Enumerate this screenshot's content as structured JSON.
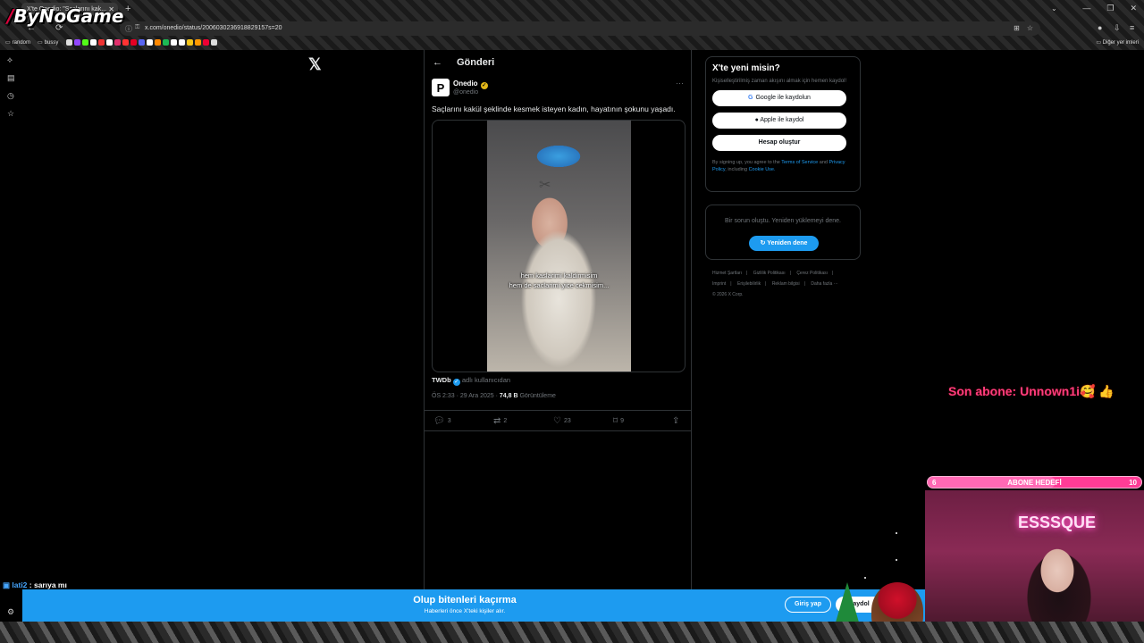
{
  "browser": {
    "tab_title": "X'te Onedio: \"Saçlarını kak...",
    "url": "x.com/onedio/status/2006030236918829157s=20",
    "bookmarks": [
      "random",
      "bussy"
    ],
    "other_bookmarks": "Diğer yer imleri",
    "overlay_logo": "ByNoGame"
  },
  "post": {
    "header_title": "Gönderi",
    "author_name": "Onedio",
    "author_handle": "@onedio",
    "text": "Saçlarını kakül şeklinde kesmek isteyen kadın, hayatının şokunu yaşadı.",
    "video_caption_line1": "hem kaslarimi kaldirmisim",
    "video_caption_line2": "hem de saclarimi yice cekmisim...",
    "credit_name": "TWDb",
    "credit_suffix": "adlı kullanıcıdan",
    "time": "ÖS 2:33 · 29 Ara 2025 · ",
    "views": "74,8 B",
    "views_label": " Görüntüleme",
    "replies": "3",
    "reposts": "2",
    "likes": "23",
    "bookmarks": "9"
  },
  "signup": {
    "title": "X'te yeni misin?",
    "subtitle": "Kişiselleştirilmiş zaman akışını almak için hemen kaydol!",
    "google": "Google ile kaydolun",
    "apple": "Apple ile kaydol",
    "create": "Hesap oluştur",
    "legal_prefix": "By signing up, you agree to the ",
    "terms": "Terms of Service",
    "and": " and ",
    "privacy": "Privacy Policy",
    "including": ", including ",
    "cookie": "Cookie Use."
  },
  "error": {
    "text": "Bir sorun oluştu. Yeniden yüklemeyi dene.",
    "retry": "Yeniden dene"
  },
  "footer": {
    "links": [
      "Hizmet Şartları",
      "|",
      "Gizlilik Politikası",
      "|",
      "Çerez Politikası",
      "|",
      "Imprint",
      "|",
      "Erişilebilirlik",
      "|",
      "Reklam bilgisi",
      "|",
      "Daha fazla ···"
    ],
    "copyright": "© 2026 X Corp."
  },
  "banner": {
    "title": "Olup bitenleri kaçırma",
    "subtitle": "Haberleri önce X'teki kişiler alır.",
    "login": "Giriş yap",
    "signup": "Kaydol"
  },
  "stream": {
    "last_sub": "Son abone: Unnown1i🥰 👍",
    "goal_label": "ABONE HEDEFİ",
    "goal_current": "6",
    "goal_target": "10",
    "goal_fraction": 0.6,
    "neon": "ESSSQUE",
    "chat_user": "lati2",
    "chat_message": " : sarıya mı"
  },
  "colors": {
    "accent": "#1d9bf0",
    "background": "#000000",
    "pink": "#ff3c96"
  },
  "icons": [
    "back-arrow-icon",
    "x-logo-icon",
    "more-icon",
    "reply-icon",
    "repost-icon",
    "like-icon",
    "bookmark-icon",
    "share-icon",
    "google-icon",
    "apple-icon",
    "refresh-icon",
    "verified-icon"
  ]
}
